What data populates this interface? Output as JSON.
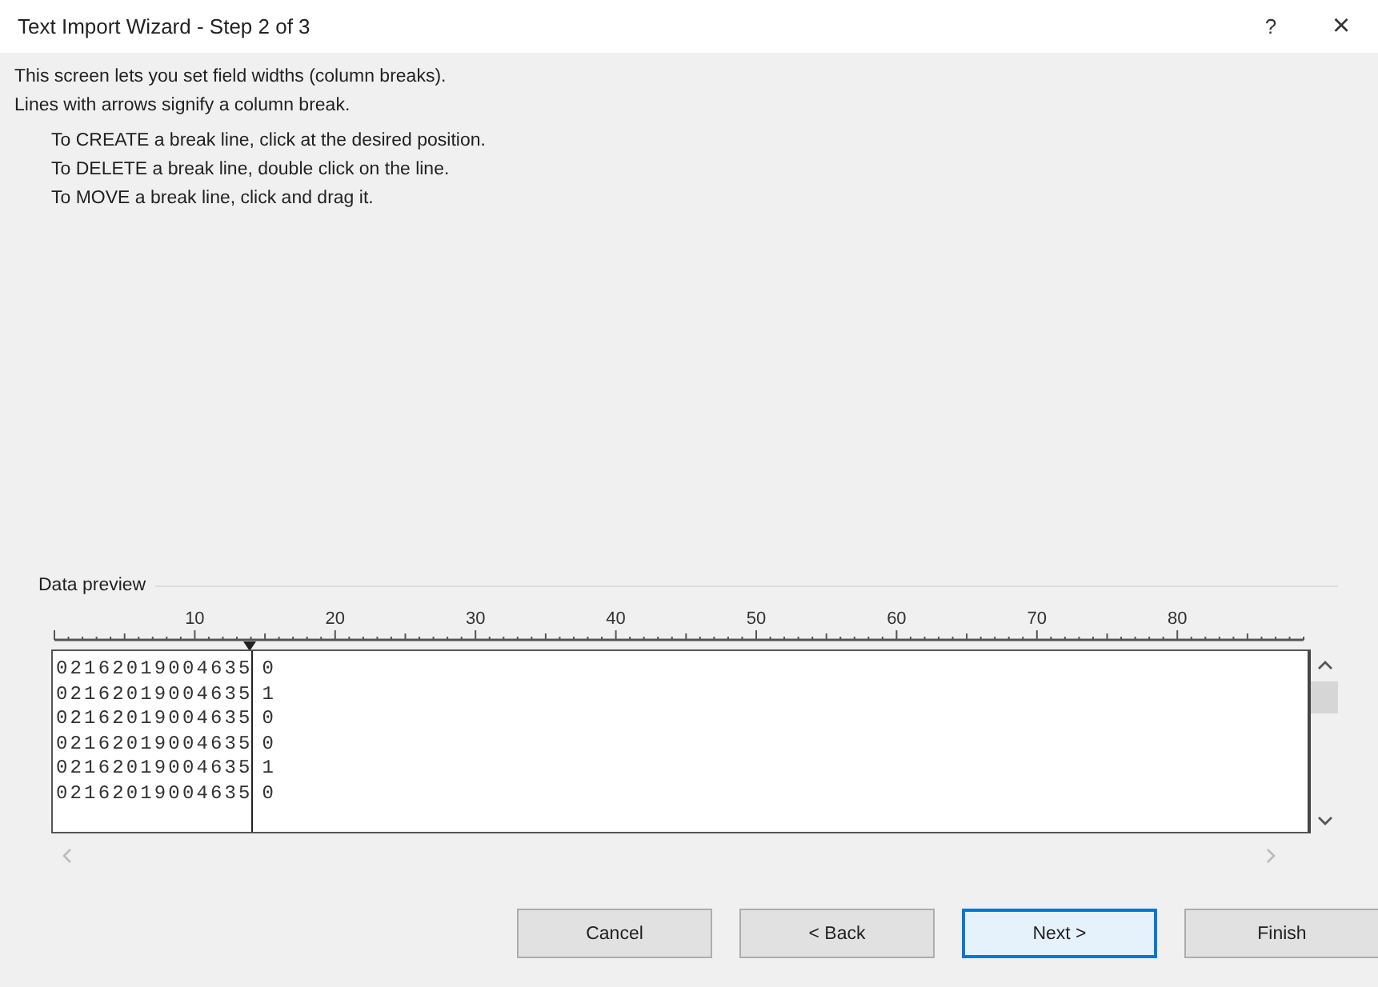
{
  "window": {
    "title": "Text Import Wizard - Step 2 of 3",
    "help": "?",
    "close": "×"
  },
  "intro": [
    "This screen lets you set field widths (column breaks).",
    "Lines with arrows signify a column break."
  ],
  "instructions": [
    "To CREATE a break line, click at the desired position.",
    "To DELETE a break line, double click on the line.",
    "To MOVE a break line, click and drag it."
  ],
  "preview": {
    "label": "Data preview",
    "ruler": [
      "10",
      "20",
      "30",
      "40",
      "50",
      "60",
      "70",
      "80"
    ],
    "rows": [
      {
        "column_1": "02162019004635",
        "column_2": "0"
      },
      {
        "column_1": "02162019004635",
        "column_2": "1"
      },
      {
        "column_1": "02162019004635",
        "column_2": "0"
      },
      {
        "column_1": "02162019004635",
        "column_2": "0"
      },
      {
        "column_1": "02162019004635",
        "column_2": "1"
      },
      {
        "column_1": "02162019004635",
        "column_2": "0"
      }
    ]
  },
  "buttons": [
    {
      "label": "Cancel",
      "default": false
    },
    {
      "label": "< Back",
      "default": false
    },
    {
      "label": "Next >",
      "default": true
    },
    {
      "label": "Finish",
      "default": false
    }
  ]
}
